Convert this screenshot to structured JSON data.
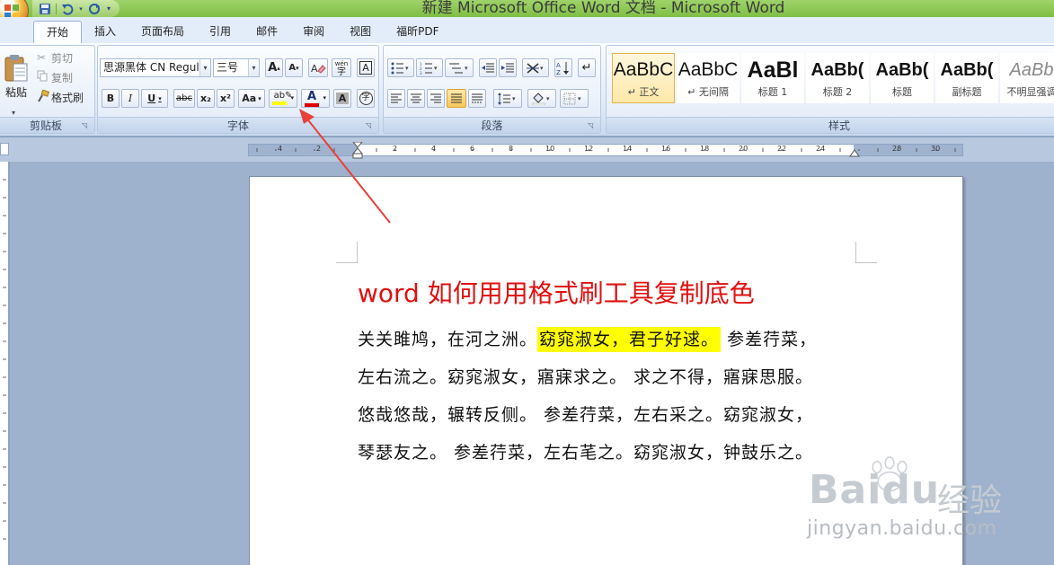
{
  "window": {
    "title": "新建 Microsoft Office Word 文档 - Microsoft Word"
  },
  "quick_access": {
    "icons": [
      "save-icon",
      "undo-icon",
      "redo-icon",
      "customize-icon"
    ]
  },
  "tabs": [
    {
      "label": "开始",
      "active": true
    },
    {
      "label": "插入"
    },
    {
      "label": "页面布局"
    },
    {
      "label": "引用"
    },
    {
      "label": "邮件"
    },
    {
      "label": "审阅"
    },
    {
      "label": "视图"
    },
    {
      "label": "福昕PDF"
    }
  ],
  "clipboard": {
    "paste": "粘贴",
    "cut": "剪切",
    "copy": "复制",
    "format_painter": "格式刷",
    "group_label": "剪贴板"
  },
  "font": {
    "font_name": "思源黑体 CN Regul",
    "font_size": "三号",
    "group_label": "字体",
    "bold": "B",
    "italic": "I",
    "underline": "U",
    "strike": "abc",
    "subscript": "x₂",
    "superscript": "x²",
    "change_case": "Aa",
    "grow": "A",
    "shrink": "A",
    "clear_format": "A",
    "phonetic": "wén",
    "border_char": "A",
    "shading_char": "A",
    "enclose": "字",
    "highlight": "ab",
    "font_color": "A"
  },
  "paragraph": {
    "group_label": "段落"
  },
  "styles": {
    "group_label": "样式",
    "items": [
      {
        "sample": "AaBbC",
        "name": "↵ 正文",
        "selected": true
      },
      {
        "sample": "AaBbC",
        "name": "↵ 无间隔"
      },
      {
        "sample": "AaBl",
        "name": "标题 1"
      },
      {
        "sample": "AaBb(",
        "name": "标题 2"
      },
      {
        "sample": "AaBb(",
        "name": "标题"
      },
      {
        "sample": "AaBb(",
        "name": "副标题"
      },
      {
        "sample": "AaBb",
        "name": "不明显强调"
      }
    ]
  },
  "ruler": {
    "numbers": [
      "4",
      "2",
      "2",
      "4",
      "6",
      "8",
      "10",
      "12",
      "14",
      "16",
      "18",
      "20",
      "22",
      "24",
      "28",
      "30"
    ]
  },
  "document": {
    "title": "word 如何用用格式刷工具复制底色",
    "line1_a": "关关雎鸠，在河之洲。",
    "line1_hl": "窈窕淑女，君子好逑。",
    "line1_b": " 参差荇菜，",
    "line2": "左右流之。窈窕淑女，寤寐求之。 求之不得，寤寐思服。",
    "line3": "悠哉悠哉，辗转反侧。 参差荇菜，左右采之。窈窕淑女，",
    "line4": "琴瑟友之。 参差荇菜，左右芼之。窈窕淑女，钟鼓乐之。"
  },
  "watermark": {
    "brand": "Bai",
    "brand2": "du",
    "cn": "经验",
    "url": "jingyan.baidu.com"
  },
  "colors": {
    "highlight": "#ffff00",
    "font_color_bar": "#e00000",
    "title_red": "#e01010",
    "arrow": "#e8413a"
  }
}
